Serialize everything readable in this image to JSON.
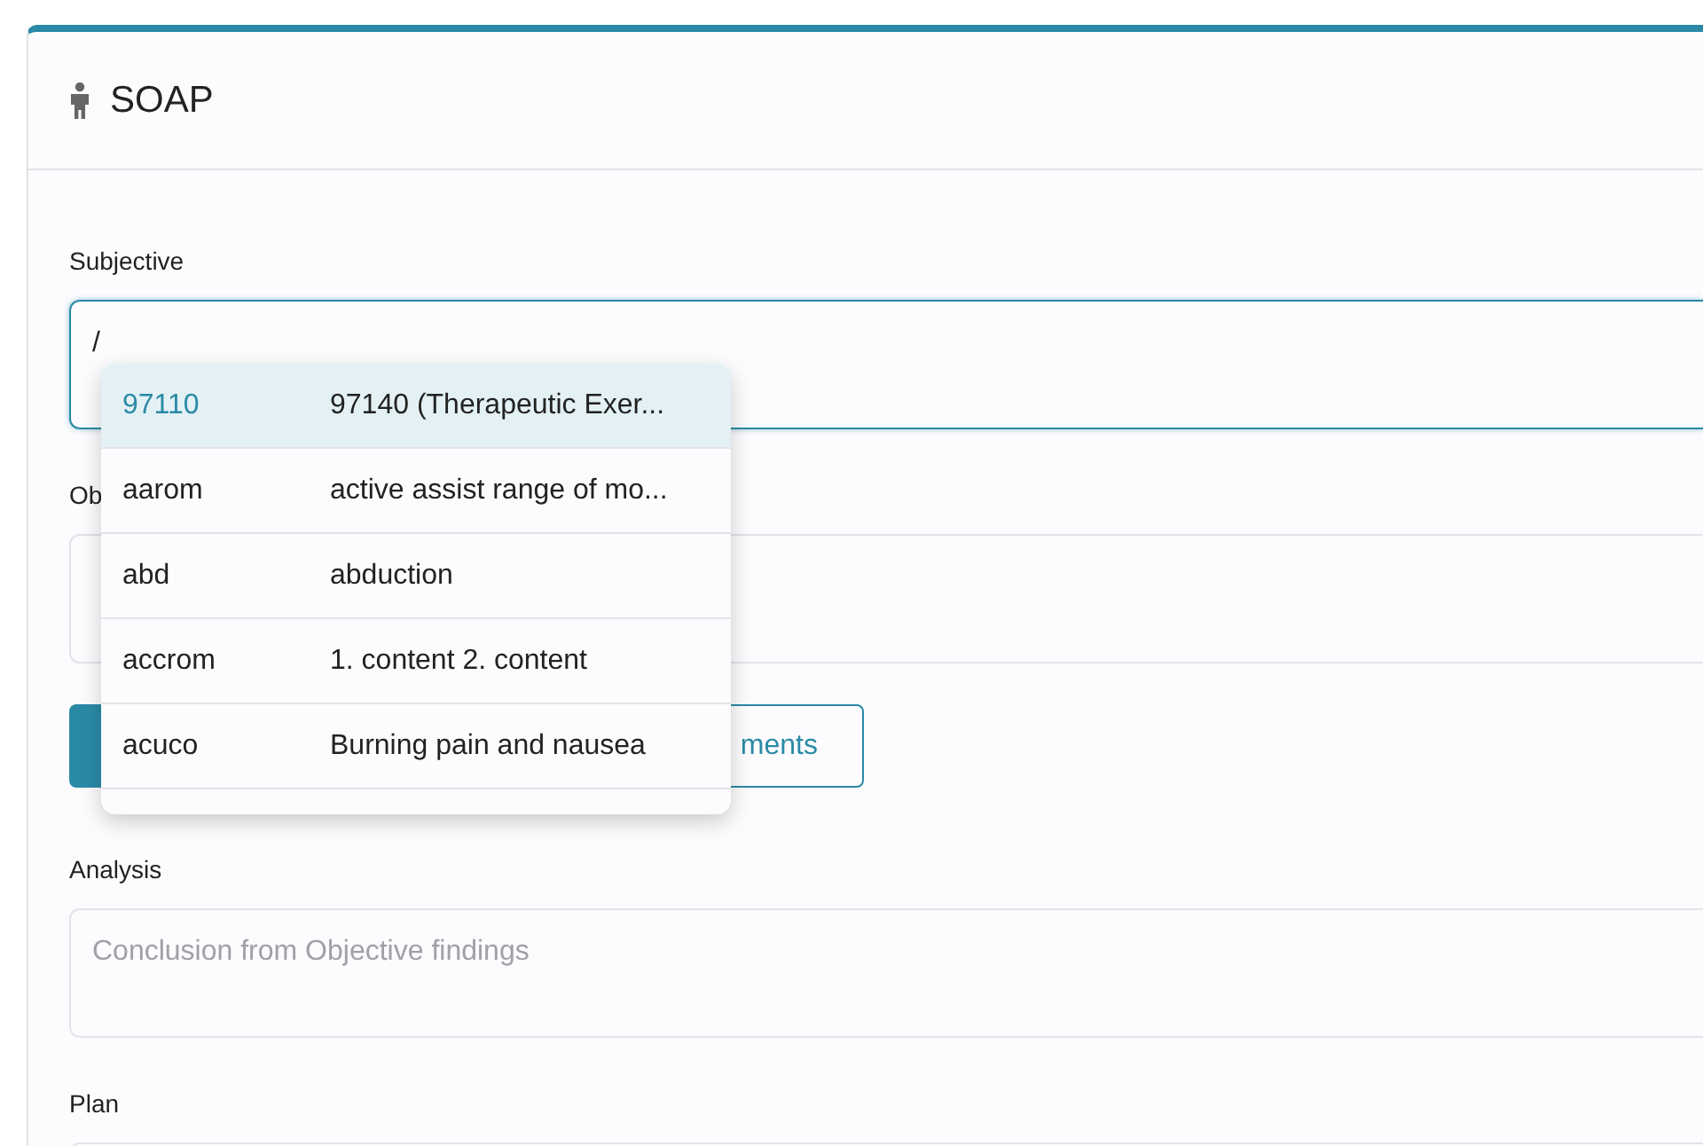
{
  "card": {
    "title": "SOAP"
  },
  "fields": [
    {
      "label": "Subjective",
      "value": "/",
      "focused": true
    },
    {
      "label": "Ob",
      "focused": false
    }
  ],
  "buttons": [
    {
      "kind": "primary"
    },
    {
      "kind": "outline",
      "label": "ments"
    }
  ],
  "fields_after": [
    {
      "label": "Analysis",
      "placeholder": "Conclusion from Objective findings"
    },
    {
      "label": "Plan"
    }
  ],
  "dropdown": [
    {
      "code": "97110",
      "text": "97140 (Therapeutic Exer...",
      "selected": true
    },
    {
      "code": "aarom",
      "text": "active assist range of mo...",
      "selected": false
    },
    {
      "code": "abd",
      "text": "abduction",
      "selected": false
    },
    {
      "code": "accrom",
      "text": "1. content 2. content",
      "selected": false
    },
    {
      "code": "acuco",
      "text": "Burning pain and nausea",
      "selected": false
    }
  ]
}
